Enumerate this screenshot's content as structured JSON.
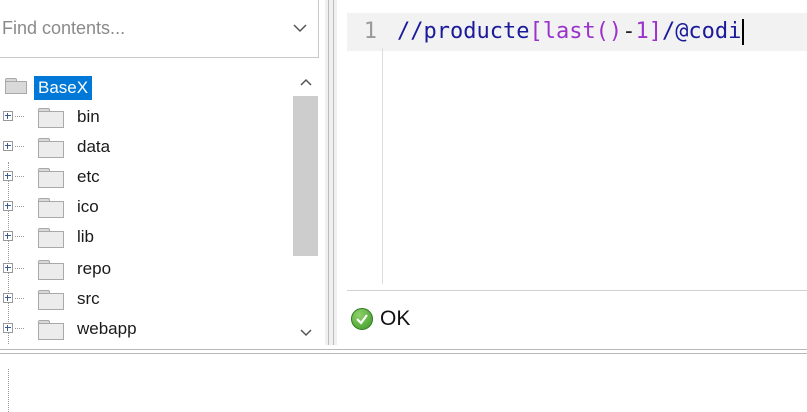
{
  "search": {
    "placeholder": "Find contents..."
  },
  "tree": {
    "root": "BaseX",
    "children": [
      "bin",
      "data",
      "etc",
      "ico",
      "lib",
      "repo",
      "src",
      "webapp"
    ]
  },
  "editor": {
    "line_number": "1",
    "code_tokens": {
      "t1": "//producte",
      "t2": "[",
      "t3": "last()",
      "t4": "-",
      "t5": "1",
      "t6": "]",
      "t7": "/",
      "t8": "@codi"
    }
  },
  "status": {
    "text": "OK"
  },
  "colors": {
    "selection": "#0078d7",
    "ok_green": "#3c9a27",
    "keyword": "#9933cc"
  }
}
